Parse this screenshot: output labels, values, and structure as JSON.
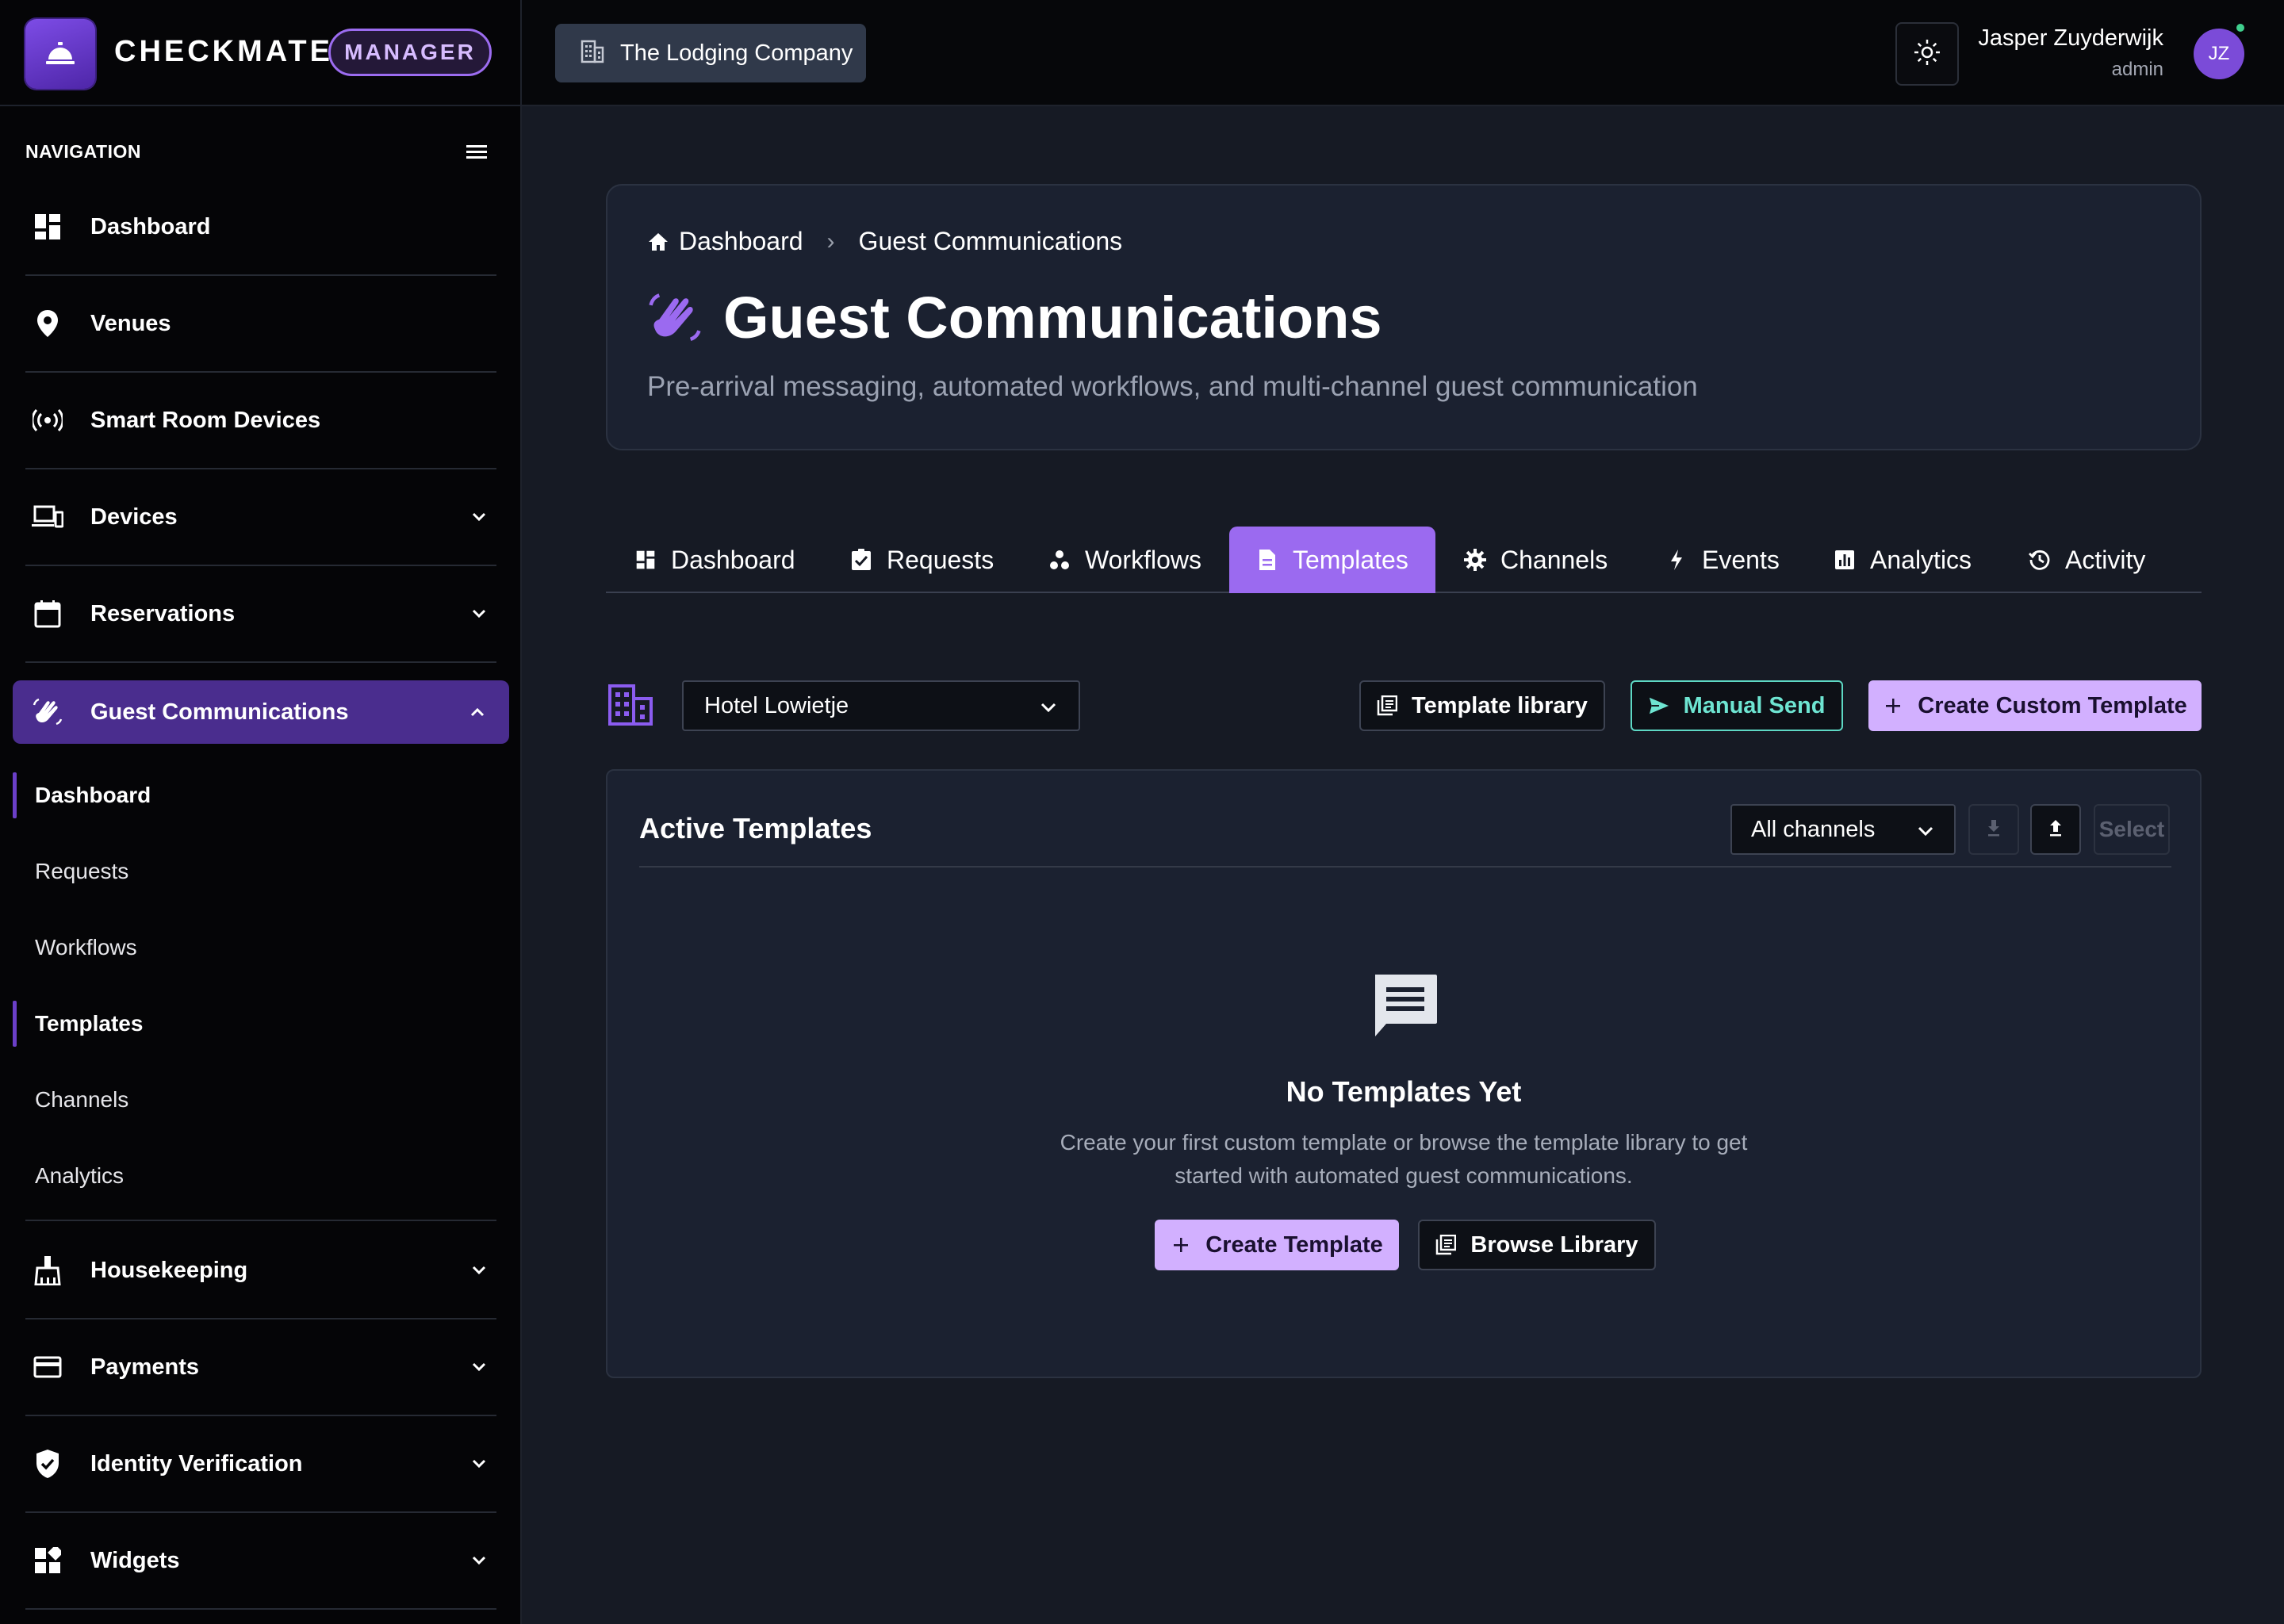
{
  "app": {
    "brand_name": "CHECKMATE",
    "brand_badge": "MANAGER"
  },
  "topbar": {
    "organization": "The Lodging Company",
    "user_name": "Jasper Zuyderwijk",
    "user_role": "admin",
    "avatar_initials": "JZ",
    "theme_icon": "sun-icon"
  },
  "sidebar": {
    "header": "NAVIGATION",
    "items": [
      {
        "label": "Dashboard",
        "icon": "dashboard-icon"
      },
      {
        "label": "Venues",
        "icon": "location-pin-icon"
      },
      {
        "label": "Smart Room Devices",
        "icon": "sensors-icon"
      },
      {
        "label": "Devices",
        "icon": "devices-icon"
      },
      {
        "label": "Reservations",
        "icon": "calendar-icon"
      },
      {
        "label": "Guest Communications",
        "icon": "waving-hand-icon"
      },
      {
        "label": "Housekeeping",
        "icon": "cleaning-icon"
      },
      {
        "label": "Payments",
        "icon": "credit-card-icon"
      },
      {
        "label": "Identity Verification",
        "icon": "shield-check-icon"
      },
      {
        "label": "Widgets",
        "icon": "widgets-icon"
      }
    ],
    "sub_items": [
      "Dashboard",
      "Requests",
      "Workflows",
      "Templates",
      "Channels",
      "Analytics"
    ]
  },
  "header": {
    "breadcrumb_home": "Dashboard",
    "breadcrumb_current": "Guest Communications",
    "title": "Guest Communications",
    "subtitle": "Pre-arrival messaging, automated workflows, and multi-channel guest communication"
  },
  "tabs": [
    {
      "label": "Dashboard",
      "icon": "dashboard-icon"
    },
    {
      "label": "Requests",
      "icon": "assignment-check-icon"
    },
    {
      "label": "Workflows",
      "icon": "workflow-icon"
    },
    {
      "label": "Templates",
      "icon": "document-icon"
    },
    {
      "label": "Channels",
      "icon": "gear-icon"
    },
    {
      "label": "Events",
      "icon": "bolt-icon"
    },
    {
      "label": "Analytics",
      "icon": "analytics-icon"
    },
    {
      "label": "Activity",
      "icon": "history-icon"
    }
  ],
  "toolbar": {
    "venue": "Hotel Lowietje",
    "template_library": "Template library",
    "manual_send": "Manual Send",
    "create_custom": "Create Custom Template"
  },
  "templates_card": {
    "title": "Active Templates",
    "channel_filter": "All channels",
    "select_label": "Select",
    "empty_title": "No Templates Yet",
    "empty_description": "Create your first custom template or browse the template library to get started with automated guest communications.",
    "create_button": "Create Template",
    "browse_button": "Browse Library"
  },
  "colors": {
    "accent": "#9b6af0",
    "primary_button": "#d2b0ff",
    "teal": "#5ed8c4",
    "sidebar_active": "#4a2d8e"
  }
}
